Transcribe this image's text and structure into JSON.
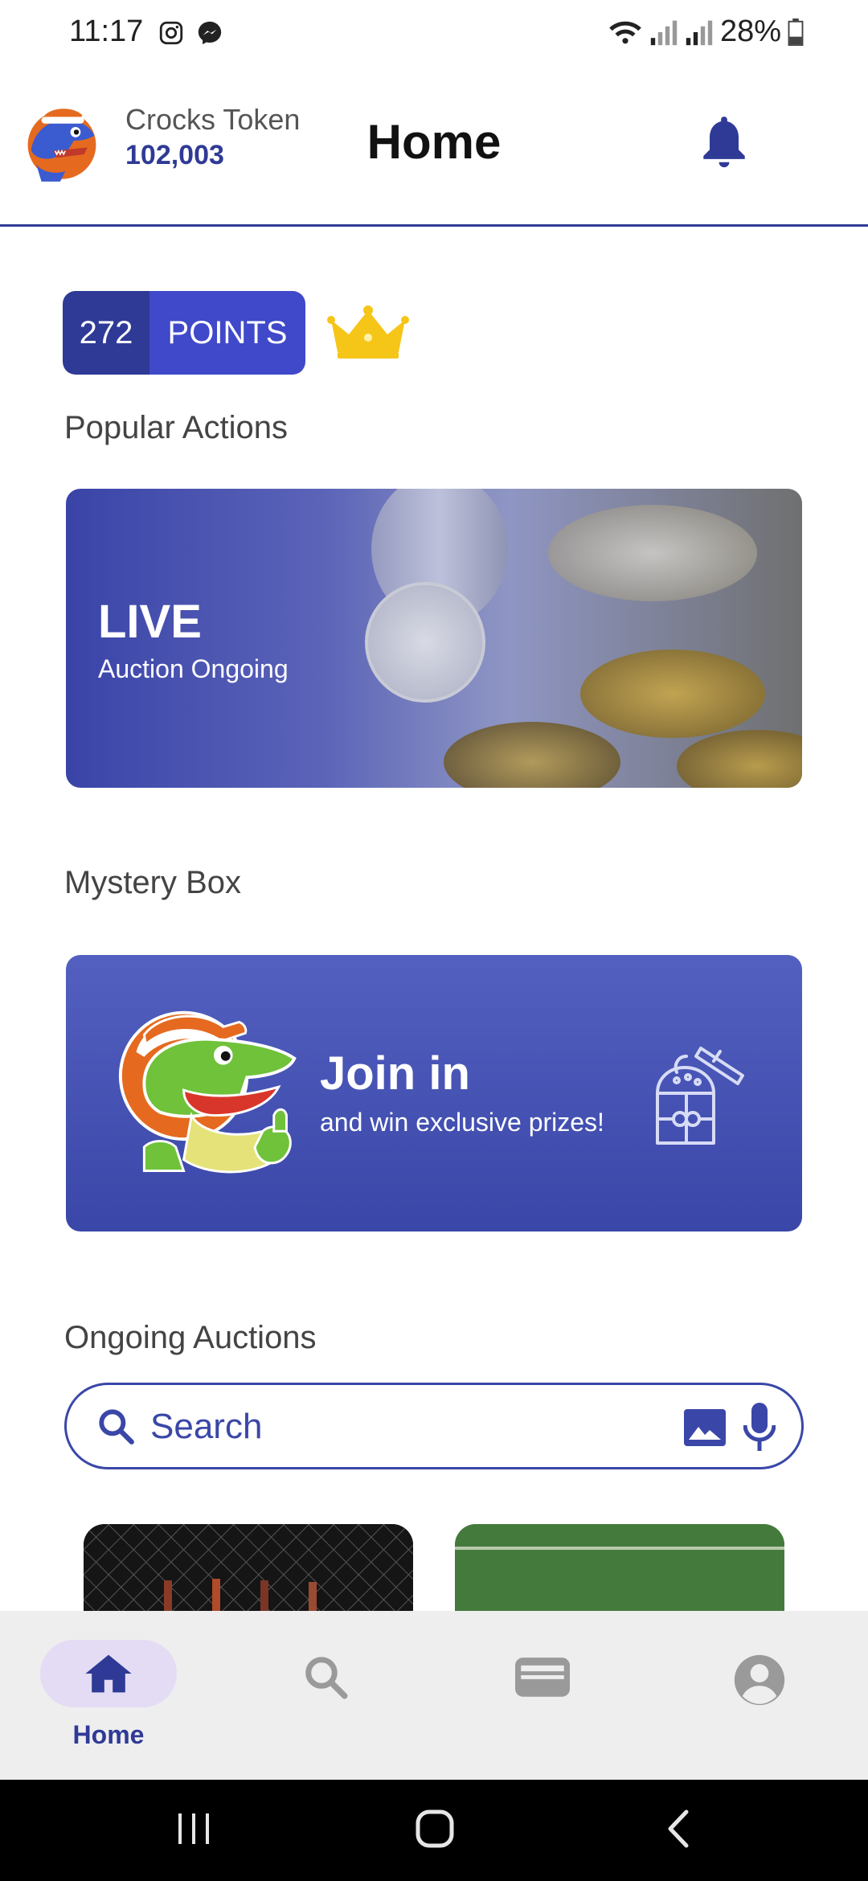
{
  "status_bar": {
    "time": "11:17",
    "battery": "28%",
    "icons": [
      "instagram-icon",
      "messenger-icon",
      "wifi-icon",
      "signal-icon",
      "signal-icon",
      "battery-icon"
    ]
  },
  "header": {
    "token_label": "Crocks Token",
    "token_value": "102,003",
    "title": "Home",
    "notification_icon": "bell-icon"
  },
  "points": {
    "value": "272",
    "label": "POINTS",
    "badge_icon": "crown-icon"
  },
  "sections": {
    "popular": "Popular Actions",
    "mystery": "Mystery Box",
    "auctions": "Ongoing Auctions"
  },
  "live_card": {
    "title": "LIVE",
    "subtitle": "Auction Ongoing"
  },
  "mystery_card": {
    "title": "Join in",
    "subtitle": "and win exclusive prizes!",
    "icon": "mystery-box-icon"
  },
  "search": {
    "placeholder": "Search",
    "icons": [
      "search-icon",
      "image-icon",
      "mic-icon"
    ]
  },
  "bottom_nav": {
    "items": [
      {
        "label": "Home",
        "icon": "home-icon",
        "active": true
      },
      {
        "label": "",
        "icon": "search-icon",
        "active": false
      },
      {
        "label": "",
        "icon": "wallet-icon",
        "active": false
      },
      {
        "label": "",
        "icon": "account-icon",
        "active": false
      }
    ]
  },
  "colors": {
    "primary": "#2f3a96",
    "accent": "#3f49c9",
    "crown": "#f5c518",
    "nav_active_pill": "#e3dcf4"
  }
}
